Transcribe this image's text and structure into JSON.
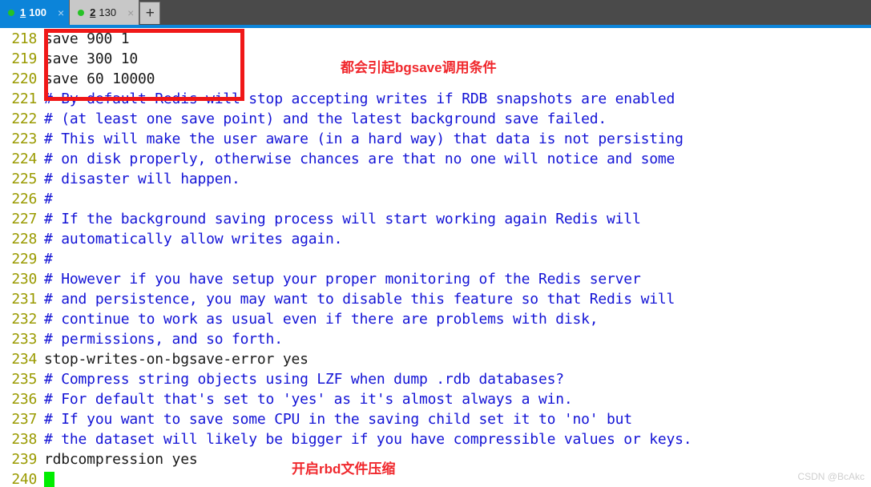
{
  "window": {
    "tabbar": {
      "background_color": "#4a4a4a",
      "accent_color": "#0c84d9",
      "tabs": [
        {
          "index": "1",
          "number": "100",
          "close_label": "×",
          "status_dot": "green-dot-icon",
          "active": true
        },
        {
          "index": "2",
          "number": "130",
          "close_label": "×",
          "status_dot": "green-dot-icon",
          "active": false
        }
      ],
      "new_tab_label": "+"
    }
  },
  "editor": {
    "language": "redis-conf",
    "first_line_number": 218,
    "lines": [
      {
        "no": "218",
        "text": "save 900 1",
        "kind": "code"
      },
      {
        "no": "219",
        "text": "save 300 10",
        "kind": "code"
      },
      {
        "no": "220",
        "text": "save 60 10000",
        "kind": "code"
      },
      {
        "no": "221",
        "text": "# By default Redis will stop accepting writes if RDB snapshots are enabled",
        "kind": "comment"
      },
      {
        "no": "222",
        "text": "# (at least one save point) and the latest background save failed.",
        "kind": "comment"
      },
      {
        "no": "223",
        "text": "# This will make the user aware (in a hard way) that data is not persisting",
        "kind": "comment"
      },
      {
        "no": "224",
        "text": "# on disk properly, otherwise chances are that no one will notice and some",
        "kind": "comment"
      },
      {
        "no": "225",
        "text": "# disaster will happen.",
        "kind": "comment"
      },
      {
        "no": "226",
        "text": "#",
        "kind": "comment"
      },
      {
        "no": "227",
        "text": "# If the background saving process will start working again Redis will",
        "kind": "comment"
      },
      {
        "no": "228",
        "text": "# automatically allow writes again.",
        "kind": "comment"
      },
      {
        "no": "229",
        "text": "#",
        "kind": "comment"
      },
      {
        "no": "230",
        "text": "# However if you have setup your proper monitoring of the Redis server",
        "kind": "comment"
      },
      {
        "no": "231",
        "text": "# and persistence, you may want to disable this feature so that Redis will",
        "kind": "comment"
      },
      {
        "no": "232",
        "text": "# continue to work as usual even if there are problems with disk,",
        "kind": "comment"
      },
      {
        "no": "233",
        "text": "# permissions, and so forth.",
        "kind": "comment"
      },
      {
        "no": "234",
        "text": "stop-writes-on-bgsave-error yes",
        "kind": "code"
      },
      {
        "no": "235",
        "text": "# Compress string objects using LZF when dump .rdb databases?",
        "kind": "comment"
      },
      {
        "no": "236",
        "text": "# For default that's set to 'yes' as it's almost always a win.",
        "kind": "comment"
      },
      {
        "no": "237",
        "text": "# If you want to save some CPU in the saving child set it to 'no' but",
        "kind": "comment"
      },
      {
        "no": "238",
        "text": "# the dataset will likely be bigger if you have compressible values or keys.",
        "kind": "comment"
      },
      {
        "no": "239",
        "text": "rdbcompression yes",
        "kind": "code"
      },
      {
        "no": "240",
        "text": "",
        "kind": "cursor"
      }
    ],
    "colors": {
      "line_number": "#9a9a00",
      "comment": "#1414d6",
      "code": "#1a1a1a",
      "cursor": "#00ee00",
      "background": "#ffffff"
    }
  },
  "annotations": {
    "highlight_color": "#f01818",
    "text_color": "#f0282d",
    "note_save_block": "都会引起bgsave调用条件",
    "note_rdbcompression": "开启rbd文件压缩"
  },
  "watermark": {
    "text": "CSDN @BcAkc"
  }
}
